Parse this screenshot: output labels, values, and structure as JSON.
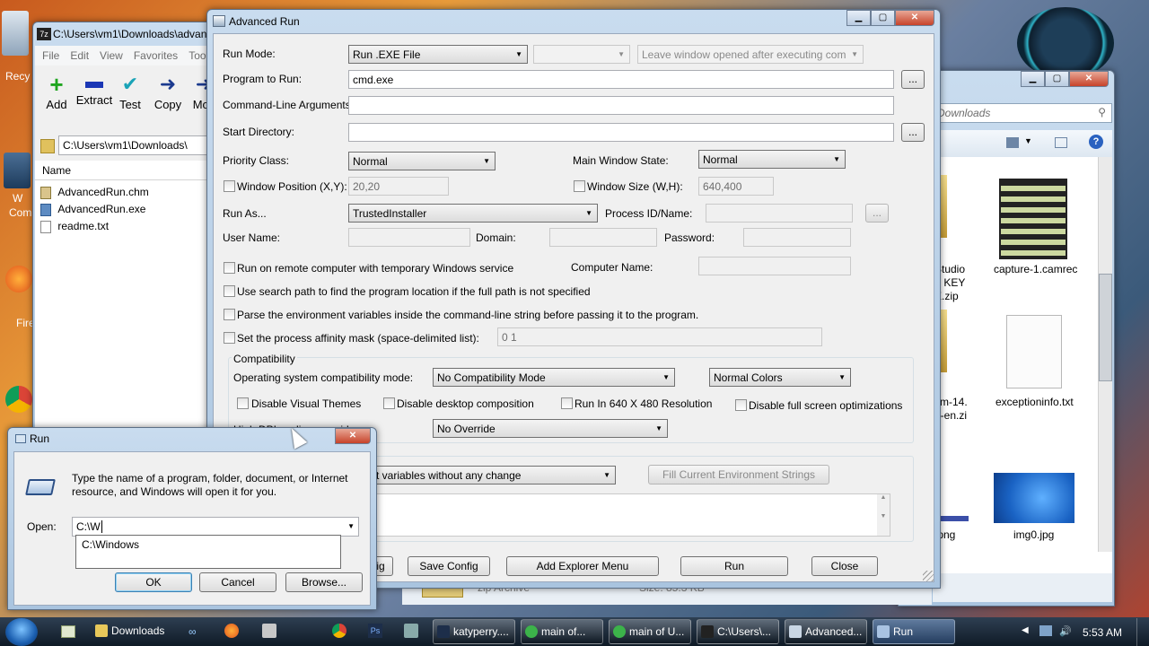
{
  "desktop": {
    "left_labels": [
      "Recy",
      "W",
      "Com",
      "Fire"
    ]
  },
  "zip_window": {
    "title": "C:\\Users\\vm1\\Downloads\\advan",
    "menu": [
      "File",
      "Edit",
      "View",
      "Favorites",
      "Too"
    ],
    "toolbar": [
      "Add",
      "Extract",
      "Test",
      "Copy",
      "Mov"
    ],
    "address": "C:\\Users\\vm1\\Downloads\\",
    "column_name": "Name",
    "files": [
      "AdvancedRun.chm",
      "AdvancedRun.exe",
      "readme.txt"
    ]
  },
  "explorer_window": {
    "search_placeholder": "Downloads",
    "items": [
      {
        "label": "capture-1.camrec"
      },
      {
        "label": "exceptioninfo.txt"
      },
      {
        "label": "img0.jpg"
      }
    ],
    "partial_labels": [
      "Studio",
      "+ KEY",
      "E.zip",
      "vm-14.",
      "6-en.zi",
      ".png"
    ],
    "status_type": "zip Archive",
    "status_size": "Size: 85.3 KB"
  },
  "advanced_run": {
    "title": "Advanced Run",
    "run_mode_label": "Run Mode:",
    "run_mode_value": "Run .EXE File",
    "leave_window": "Leave window opened after executing command",
    "program_label": "Program to Run:",
    "program_value": "cmd.exe",
    "args_label": "Command-Line Arguments:",
    "start_dir_label": "Start Directory:",
    "browse_dots": "...",
    "priority_label": "Priority Class:",
    "priority_value": "Normal",
    "main_window_label": "Main Window State:",
    "main_window_value": "Normal",
    "window_pos_label": "Window Position (X,Y):",
    "window_pos_value": "20,20",
    "window_size_label": "Window Size (W,H):",
    "window_size_value": "640,400",
    "run_as_label": "Run As...",
    "run_as_value": "TrustedInstaller",
    "process_label": "Process ID/Name:",
    "user_label": "User Name:",
    "domain_label": "Domain:",
    "password_label": "Password:",
    "remote_label": "Run on remote computer with temporary Windows service",
    "computer_label": "Computer Name:",
    "search_path_label": "Use search path to find the program location if the full path is not specified",
    "parse_env_label": "Parse the environment variables inside the command-line string before passing it to the program.",
    "affinity_label": "Set the process affinity mask (space-delimited list):",
    "affinity_value": "0 1",
    "compat_group": "Compatibility",
    "os_compat_label": "Operating system compatibility mode:",
    "os_compat_value": "No Compatibility Mode",
    "colors_value": "Normal Colors",
    "disable_themes": "Disable Visual Themes",
    "disable_desktop": "Disable desktop composition",
    "run_640": "Run In 640 X 480 Resolution",
    "disable_fullscreen": "Disable full screen optimizations",
    "high_dpi_partial": "High DPI scaling override:",
    "dpi_value": "No Override",
    "env_value": "t variables without any change",
    "fill_env": "Fill Current Environment Strings",
    "load_partial": "ig",
    "save_config": "Save Config",
    "add_explorer": "Add Explorer Menu",
    "run": "Run",
    "close": "Close"
  },
  "run_dialog": {
    "title": "Run",
    "description": "Type the name of a program, folder, document, or Internet resource, and Windows will open it for you.",
    "open_label": "Open:",
    "open_value": "C:\\W",
    "suggestion": "C:\\Windows",
    "ok": "OK",
    "cancel": "Cancel",
    "browse": "Browse..."
  },
  "taskbar": {
    "downloads": "Downloads",
    "tasks": [
      "katyperry....",
      "main of...",
      "main of U...",
      "C:\\Users\\...",
      "Advanced...",
      "Run"
    ],
    "time": "5:53 AM"
  }
}
